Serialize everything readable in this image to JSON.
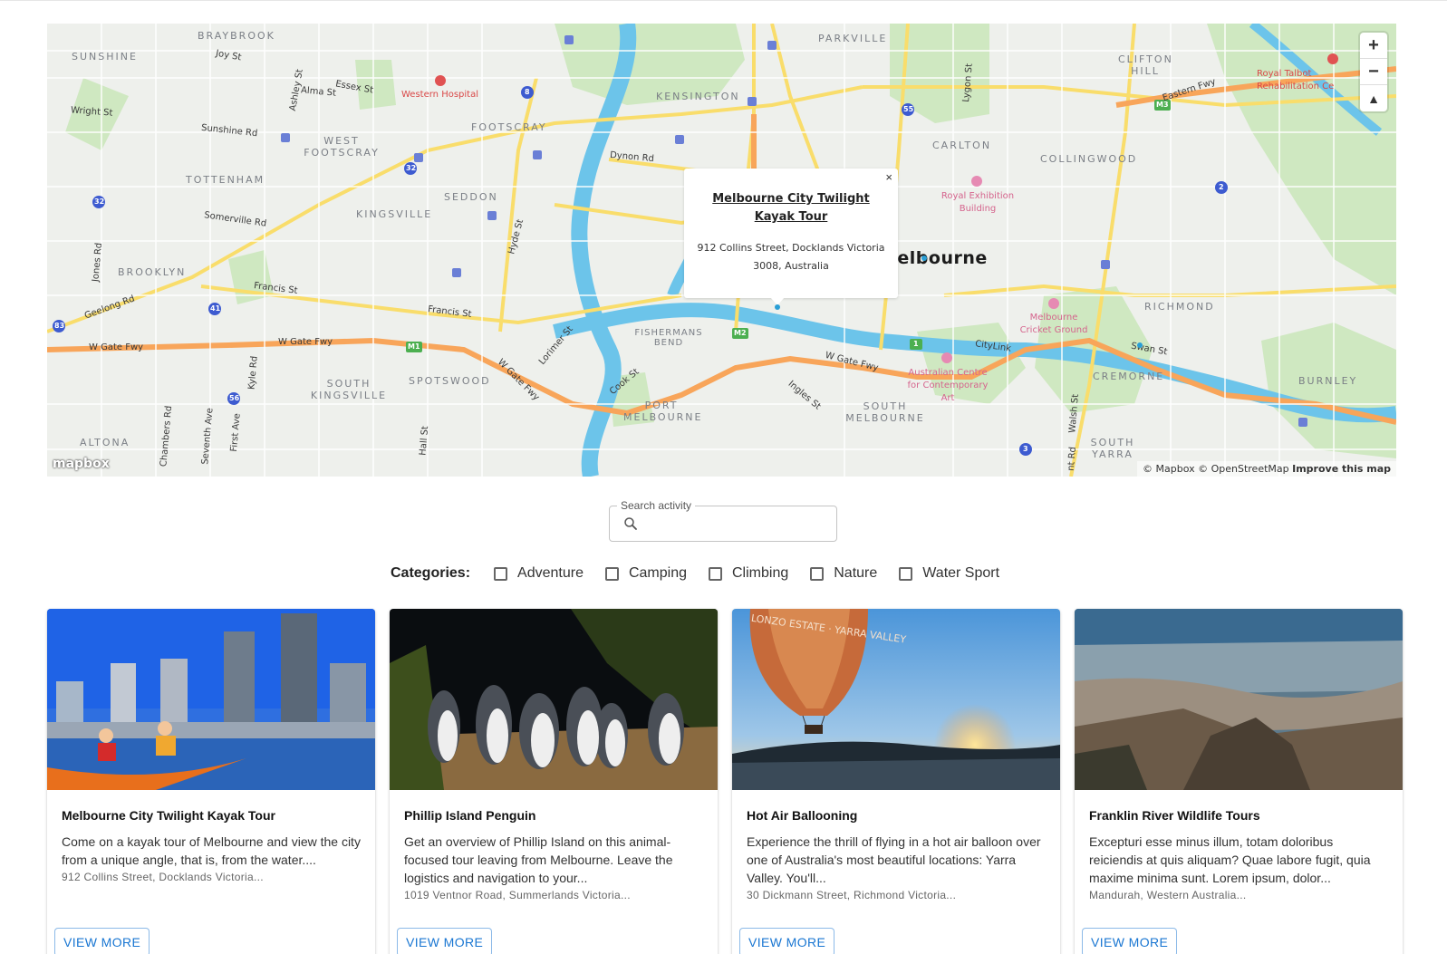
{
  "map": {
    "popup": {
      "close": "×",
      "title": "Melbourne City Twilight Kayak Tour",
      "address": "912 Collins Street, Docklands Victoria 3008, Australia"
    },
    "controls": {
      "zoom_in": "+",
      "zoom_out": "−",
      "compass": "▲"
    },
    "logo": "mapbox",
    "attribution": {
      "mapbox": "© Mapbox",
      "osm": "© OpenStreetMap",
      "improve": "Improve this map"
    },
    "labels": {
      "braybrook": "BRAYBROOK",
      "sunshine": "SUNSHINE",
      "parkville": "PARKVILLE",
      "clifton_hill": "CLIFTON HILL",
      "kensington": "KENSINGTON",
      "footscray": "FOOTSCRAY",
      "west_footscray": "WEST FOOTSCRAY",
      "tottenham": "TOTTENHAM",
      "seddon": "SEDDON",
      "kingsville": "KINGSVILLE",
      "brooklyn": "BROOKLYN",
      "carlton": "CARLTON",
      "collingwood": "COLLINGWOOD",
      "richmond": "RICHMOND",
      "cremorne": "CREMORNE",
      "burnley": "BURNLEY",
      "fishermans_bend": "FISHERMANS BEND",
      "port_melbourne": "PORT MELBOURNE",
      "south_melbourne": "SOUTH MELBOURNE",
      "spotswood": "SPOTSWOOD",
      "south_kingsville": "SOUTH KINGSVILLE",
      "altona": "ALTONA",
      "south_yarra": "SOUTH YARRA",
      "melbourne": "Melbourne",
      "western_hospital": "Western Hospital",
      "royal_exhibition": "Royal Exhibition Building",
      "mcg": "Melbourne Cricket Ground",
      "acca": "Australian Centre for Contemporary Art",
      "royal_talbot": "Royal Talbot Rehabilitation Ce",
      "joy_st": "Joy St",
      "alma_st": "Alma St",
      "essex_st": "Essex St",
      "wright_st": "Wright St",
      "sunshine_rd": "Sunshine Rd",
      "dynon_rd": "Dynon Rd",
      "somerville_rd": "Somerville Rd",
      "francis_st_1": "Francis St",
      "francis_st_2": "Francis St",
      "geelong_rd": "Geelong Rd",
      "w_gate_fwy_1": "W Gate Fwy",
      "w_gate_fwy_2": "W Gate Fwy",
      "w_gate_fwy_3": "W Gate Fwy",
      "w_gate_fwy_4": "W Gate Fwy",
      "eastern_fwy": "Eastern Fwy",
      "citylink": "CityLink",
      "swan_st": "Swan St",
      "cook_st": "Cook St",
      "ingles_st": "Ingles St",
      "lorimer_st": "Lorimer St",
      "hyde_st": "Hyde St",
      "ashley_st": "Ashley St",
      "jones_rd": "Jones Rd",
      "kyle_rd": "Kyle Rd",
      "chambers_rd": "Chambers Rd",
      "seventh_ave": "Seventh Ave",
      "first_ave": "First Ave",
      "hall_st": "Hall St",
      "lygon_st": "Lygon St",
      "walsh_st": "Walsh St",
      "punt_rd": "nt Rd"
    },
    "shields": {
      "m3": "M3",
      "m2": "M2",
      "m1": "M1",
      "r32a": "32",
      "r32b": "32",
      "r8": "8",
      "r41": "41",
      "r56": "56",
      "r83": "83",
      "r55": "55",
      "r2": "2",
      "r3": "3",
      "r1": "1"
    }
  },
  "search": {
    "label": "Search activity",
    "placeholder": "",
    "value": ""
  },
  "categories": {
    "label": "Categories:",
    "items": [
      "Adventure",
      "Camping",
      "Climbing",
      "Nature",
      "Water Sport"
    ]
  },
  "cards": [
    {
      "title": "Melbourne City Twilight Kayak Tour",
      "description": "Come on a kayak tour of Melbourne and view the city from a unique angle, that is, from the water....",
      "address": "912 Collins Street, Docklands Victoria...",
      "button": "VIEW MORE"
    },
    {
      "title": "Phillip Island Penguin",
      "description": "Get an overview of Phillip Island on this animal-focused tour leaving from Melbourne. Leave the logistics and navigation to your...",
      "address": "1019 Ventnor Road, Summerlands Victoria...",
      "button": "VIEW MORE"
    },
    {
      "title": "Hot Air Ballooning",
      "description": "Experience the thrill of flying in a hot air balloon over one of Australia's most beautiful locations: Yarra Valley. You'll...",
      "address": "30 Dickmann Street, Richmond Victoria...",
      "balloon_text": "LONZO ESTATE · YARRA VALLEY",
      "button": "VIEW MORE"
    },
    {
      "title": "Franklin River Wildlife Tours",
      "description": "Excepturi esse minus illum, totam doloribus reiciendis at quis aliquam? Quae labore fugit, quia maxime minima sunt. Lorem ipsum, dolor...",
      "address": "Mandurah, Western Australia...",
      "button": "VIEW MORE"
    }
  ],
  "colors": {
    "accent": "#1976d2",
    "map_water": "#6cc4ea",
    "map_park": "#cfe8c1",
    "map_highway": "#f8a55a",
    "map_major_road": "#f9dd6b"
  }
}
